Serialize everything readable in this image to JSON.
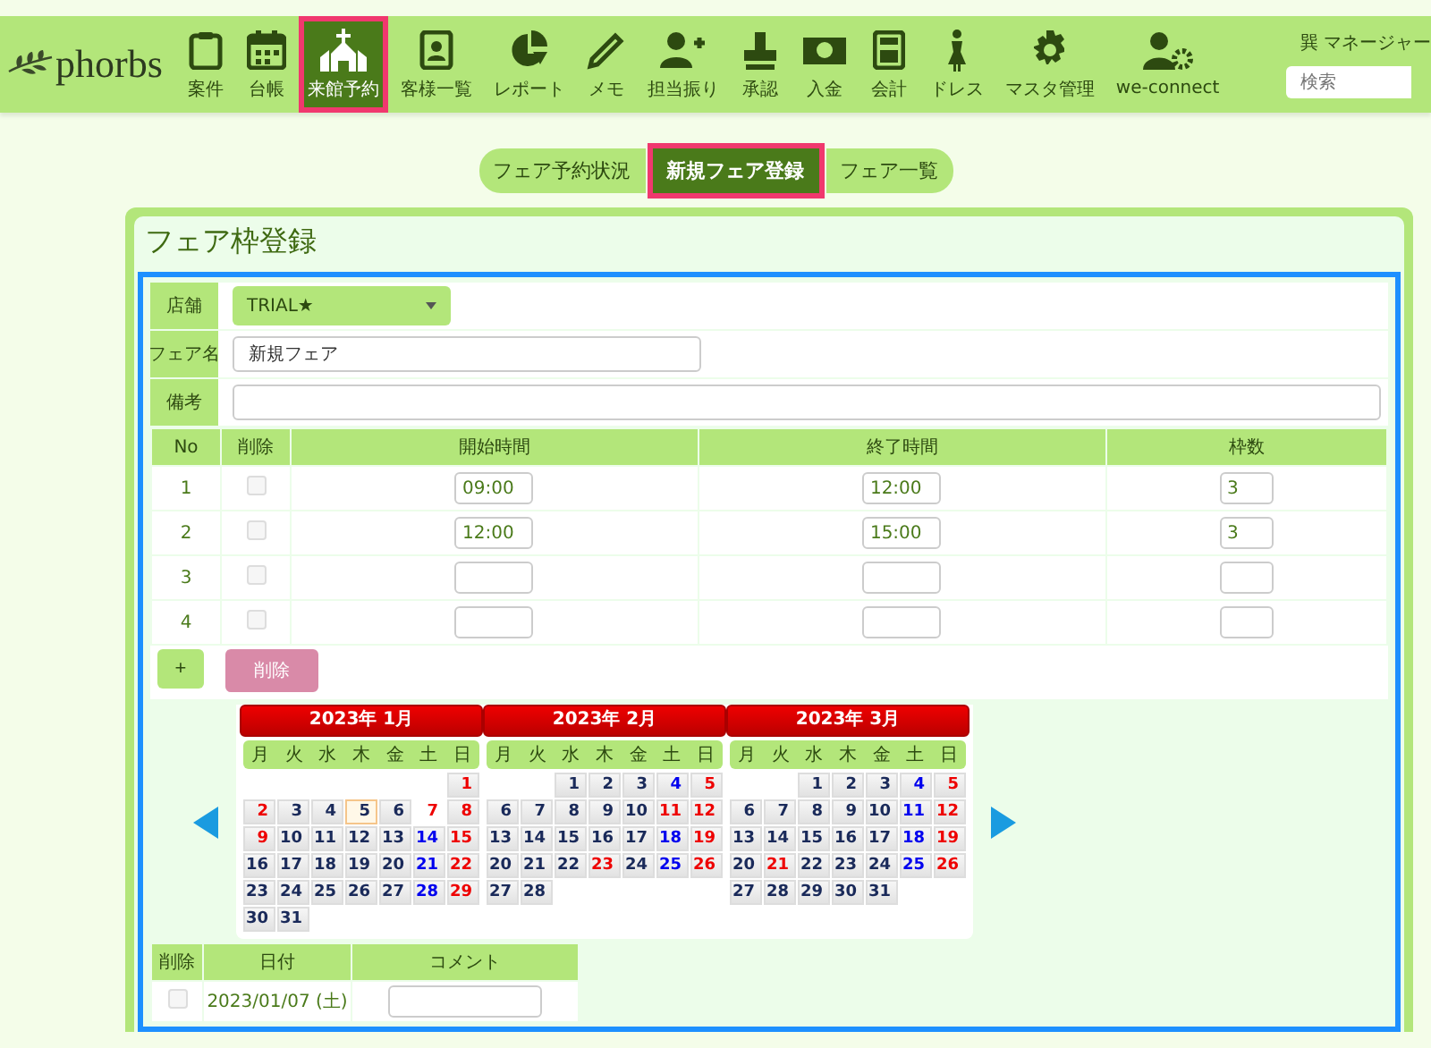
{
  "logo": "phorbs",
  "nav": [
    {
      "label": "案件",
      "selected": false
    },
    {
      "label": "台帳",
      "selected": false
    },
    {
      "label": "来館予約",
      "selected": true
    },
    {
      "label": "客様一覧",
      "selected": false
    },
    {
      "label": "レポート",
      "selected": false
    },
    {
      "label": "メモ",
      "selected": false
    },
    {
      "label": "担当振り",
      "selected": false
    },
    {
      "label": "承認",
      "selected": false
    },
    {
      "label": "入金",
      "selected": false
    },
    {
      "label": "会計",
      "selected": false
    },
    {
      "label": "ドレス",
      "selected": false
    },
    {
      "label": "マスタ管理",
      "selected": false
    },
    {
      "label": "we-connect",
      "selected": false
    }
  ],
  "user": "巽 マネージャー",
  "search": {
    "placeholder": "検索"
  },
  "tabs": [
    {
      "label": "フェア予約状況",
      "selected": false
    },
    {
      "label": "新規フェア登録",
      "selected": true
    },
    {
      "label": "フェア一覧",
      "selected": false
    }
  ],
  "panel_title": "フェア枠登録",
  "form": {
    "store_label": "店舗",
    "store_value": "TRIAL★",
    "name_label": "フェア名",
    "name_value": "新規フェア",
    "note_label": "備考"
  },
  "slots": {
    "columns": [
      "No",
      "削除",
      "開始時間",
      "終了時間",
      "枠数"
    ],
    "rows": [
      {
        "no": "1",
        "checked": false,
        "start": "09:00",
        "end": "12:00",
        "count": "3"
      },
      {
        "no": "2",
        "checked": false,
        "start": "12:00",
        "end": "15:00",
        "count": "3"
      },
      {
        "no": "3",
        "checked": false
      },
      {
        "no": "4",
        "checked": false
      }
    ],
    "add_button": "+",
    "delete_button": "削除"
  },
  "calendar": {
    "months": [
      {
        "title": "2023年 1月",
        "weekdays": [
          "月",
          "火",
          "水",
          "木",
          "金",
          "土",
          "日"
        ],
        "weeks": [
          [
            {
              "kind": "blank"
            },
            {
              "kind": "blank"
            },
            {
              "kind": "blank"
            },
            {
              "kind": "blank"
            },
            {
              "kind": "blank"
            },
            {
              "kind": "blank"
            },
            {
              "kind": "day",
              "d": "1",
              "color": "#ee0000",
              "selected": false
            }
          ],
          [
            {
              "kind": "day",
              "d": "2",
              "color": "#ee0000",
              "selected": false
            },
            {
              "kind": "day",
              "d": "3",
              "color": "#1a2a5a",
              "selected": false
            },
            {
              "kind": "day",
              "d": "4",
              "color": "#1a2a5a",
              "selected": false
            },
            {
              "kind": "today",
              "d": "5",
              "color": "#1a2a5a",
              "selected": false
            },
            {
              "kind": "day",
              "d": "6",
              "color": "#1a2a5a",
              "selected": false
            },
            {
              "kind": "day",
              "d": "7",
              "color": "#ee0000",
              "selected": true
            },
            {
              "kind": "day",
              "d": "8",
              "color": "#ee0000",
              "selected": false
            }
          ],
          [
            {
              "kind": "day",
              "d": "9",
              "color": "#ee0000",
              "selected": false
            },
            {
              "kind": "day",
              "d": "10",
              "color": "#1a2a5a",
              "selected": false
            },
            {
              "kind": "day",
              "d": "11",
              "color": "#1a2a5a",
              "selected": false
            },
            {
              "kind": "day",
              "d": "12",
              "color": "#1a2a5a",
              "selected": false
            },
            {
              "kind": "day",
              "d": "13",
              "color": "#1a2a5a",
              "selected": false
            },
            {
              "kind": "day",
              "d": "14",
              "color": "#0000ee",
              "selected": false
            },
            {
              "kind": "day",
              "d": "15",
              "color": "#ee0000",
              "selected": false
            }
          ],
          [
            {
              "kind": "day",
              "d": "16",
              "color": "#1a2a5a",
              "selected": false
            },
            {
              "kind": "day",
              "d": "17",
              "color": "#1a2a5a",
              "selected": false
            },
            {
              "kind": "day",
              "d": "18",
              "color": "#1a2a5a",
              "selected": false
            },
            {
              "kind": "day",
              "d": "19",
              "color": "#1a2a5a",
              "selected": false
            },
            {
              "kind": "day",
              "d": "20",
              "color": "#1a2a5a",
              "selected": false
            },
            {
              "kind": "day",
              "d": "21",
              "color": "#0000ee",
              "selected": false
            },
            {
              "kind": "day",
              "d": "22",
              "color": "#ee0000",
              "selected": false
            }
          ],
          [
            {
              "kind": "day",
              "d": "23",
              "color": "#1a2a5a",
              "selected": false
            },
            {
              "kind": "day",
              "d": "24",
              "color": "#1a2a5a",
              "selected": false
            },
            {
              "kind": "day",
              "d": "25",
              "color": "#1a2a5a",
              "selected": false
            },
            {
              "kind": "day",
              "d": "26",
              "color": "#1a2a5a",
              "selected": false
            },
            {
              "kind": "day",
              "d": "27",
              "color": "#1a2a5a",
              "selected": false
            },
            {
              "kind": "day",
              "d": "28",
              "color": "#0000ee",
              "selected": false
            },
            {
              "kind": "day",
              "d": "29",
              "color": "#ee0000",
              "selected": false
            }
          ],
          [
            {
              "kind": "day",
              "d": "30",
              "color": "#1a2a5a",
              "selected": false
            },
            {
              "kind": "day",
              "d": "31",
              "color": "#1a2a5a",
              "selected": false
            }
          ]
        ]
      },
      {
        "title": "2023年 2月",
        "weekdays": [
          "月",
          "火",
          "水",
          "木",
          "金",
          "土",
          "日"
        ],
        "weeks": [
          [
            {
              "kind": "blank"
            },
            {
              "kind": "blank"
            },
            {
              "kind": "day",
              "d": "1",
              "color": "#1a2a5a",
              "selected": false
            },
            {
              "kind": "day",
              "d": "2",
              "color": "#1a2a5a",
              "selected": false
            },
            {
              "kind": "day",
              "d": "3",
              "color": "#1a2a5a",
              "selected": false
            },
            {
              "kind": "day",
              "d": "4",
              "color": "#0000ee",
              "selected": false
            },
            {
              "kind": "day",
              "d": "5",
              "color": "#ee0000",
              "selected": false
            }
          ],
          [
            {
              "kind": "day",
              "d": "6",
              "color": "#1a2a5a",
              "selected": false
            },
            {
              "kind": "day",
              "d": "7",
              "color": "#1a2a5a",
              "selected": false
            },
            {
              "kind": "day",
              "d": "8",
              "color": "#1a2a5a",
              "selected": false
            },
            {
              "kind": "day",
              "d": "9",
              "color": "#1a2a5a",
              "selected": false
            },
            {
              "kind": "day",
              "d": "10",
              "color": "#1a2a5a",
              "selected": false
            },
            {
              "kind": "day",
              "d": "11",
              "color": "#ee0000",
              "selected": false
            },
            {
              "kind": "day",
              "d": "12",
              "color": "#ee0000",
              "selected": false
            }
          ],
          [
            {
              "kind": "day",
              "d": "13",
              "color": "#1a2a5a",
              "selected": false
            },
            {
              "kind": "day",
              "d": "14",
              "color": "#1a2a5a",
              "selected": false
            },
            {
              "kind": "day",
              "d": "15",
              "color": "#1a2a5a",
              "selected": false
            },
            {
              "kind": "day",
              "d": "16",
              "color": "#1a2a5a",
              "selected": false
            },
            {
              "kind": "day",
              "d": "17",
              "color": "#1a2a5a",
              "selected": false
            },
            {
              "kind": "day",
              "d": "18",
              "color": "#0000ee",
              "selected": false
            },
            {
              "kind": "day",
              "d": "19",
              "color": "#ee0000",
              "selected": false
            }
          ],
          [
            {
              "kind": "day",
              "d": "20",
              "color": "#1a2a5a",
              "selected": false
            },
            {
              "kind": "day",
              "d": "21",
              "color": "#1a2a5a",
              "selected": false
            },
            {
              "kind": "day",
              "d": "22",
              "color": "#1a2a5a",
              "selected": false
            },
            {
              "kind": "day",
              "d": "23",
              "color": "#ee0000",
              "selected": false
            },
            {
              "kind": "day",
              "d": "24",
              "color": "#1a2a5a",
              "selected": false
            },
            {
              "kind": "day",
              "d": "25",
              "color": "#0000ee",
              "selected": false
            },
            {
              "kind": "day",
              "d": "26",
              "color": "#ee0000",
              "selected": false
            }
          ],
          [
            {
              "kind": "day",
              "d": "27",
              "color": "#1a2a5a",
              "selected": false
            },
            {
              "kind": "day",
              "d": "28",
              "color": "#1a2a5a",
              "selected": false
            }
          ]
        ]
      },
      {
        "title": "2023年 3月",
        "weekdays": [
          "月",
          "火",
          "水",
          "木",
          "金",
          "土",
          "日"
        ],
        "weeks": [
          [
            {
              "kind": "blank"
            },
            {
              "kind": "blank"
            },
            {
              "kind": "day",
              "d": "1",
              "color": "#1a2a5a",
              "selected": false
            },
            {
              "kind": "day",
              "d": "2",
              "color": "#1a2a5a",
              "selected": false
            },
            {
              "kind": "day",
              "d": "3",
              "color": "#1a2a5a",
              "selected": false
            },
            {
              "kind": "day",
              "d": "4",
              "color": "#0000ee",
              "selected": false
            },
            {
              "kind": "day",
              "d": "5",
              "color": "#ee0000",
              "selected": false
            }
          ],
          [
            {
              "kind": "day",
              "d": "6",
              "color": "#1a2a5a",
              "selected": false
            },
            {
              "kind": "day",
              "d": "7",
              "color": "#1a2a5a",
              "selected": false
            },
            {
              "kind": "day",
              "d": "8",
              "color": "#1a2a5a",
              "selected": false
            },
            {
              "kind": "day",
              "d": "9",
              "color": "#1a2a5a",
              "selected": false
            },
            {
              "kind": "day",
              "d": "10",
              "color": "#1a2a5a",
              "selected": false
            },
            {
              "kind": "day",
              "d": "11",
              "color": "#0000ee",
              "selected": false
            },
            {
              "kind": "day",
              "d": "12",
              "color": "#ee0000",
              "selected": false
            }
          ],
          [
            {
              "kind": "day",
              "d": "13",
              "color": "#1a2a5a",
              "selected": false
            },
            {
              "kind": "day",
              "d": "14",
              "color": "#1a2a5a",
              "selected": false
            },
            {
              "kind": "day",
              "d": "15",
              "color": "#1a2a5a",
              "selected": false
            },
            {
              "kind": "day",
              "d": "16",
              "color": "#1a2a5a",
              "selected": false
            },
            {
              "kind": "day",
              "d": "17",
              "color": "#1a2a5a",
              "selected": false
            },
            {
              "kind": "day",
              "d": "18",
              "color": "#0000ee",
              "selected": false
            },
            {
              "kind": "day",
              "d": "19",
              "color": "#ee0000",
              "selected": false
            }
          ],
          [
            {
              "kind": "day",
              "d": "20",
              "color": "#1a2a5a",
              "selected": false
            },
            {
              "kind": "day",
              "d": "21",
              "color": "#ee0000",
              "selected": false
            },
            {
              "kind": "day",
              "d": "22",
              "color": "#1a2a5a",
              "selected": false
            },
            {
              "kind": "day",
              "d": "23",
              "color": "#1a2a5a",
              "selected": false
            },
            {
              "kind": "day",
              "d": "24",
              "color": "#1a2a5a",
              "selected": false
            },
            {
              "kind": "day",
              "d": "25",
              "color": "#0000ee",
              "selected": false
            },
            {
              "kind": "day",
              "d": "26",
              "color": "#ee0000",
              "selected": false
            }
          ],
          [
            {
              "kind": "day",
              "d": "27",
              "color": "#1a2a5a",
              "selected": false
            },
            {
              "kind": "day",
              "d": "28",
              "color": "#1a2a5a",
              "selected": false
            },
            {
              "kind": "day",
              "d": "29",
              "color": "#1a2a5a",
              "selected": false
            },
            {
              "kind": "day",
              "d": "30",
              "color": "#1a2a5a",
              "selected": false
            },
            {
              "kind": "day",
              "d": "31",
              "color": "#1a2a5a",
              "selected": false
            }
          ]
        ]
      }
    ]
  },
  "selected_dates": {
    "columns": [
      "削除",
      "日付",
      "コメント"
    ],
    "rows": [
      {
        "checked": false,
        "date": "2023/01/07 (土)"
      }
    ]
  }
}
